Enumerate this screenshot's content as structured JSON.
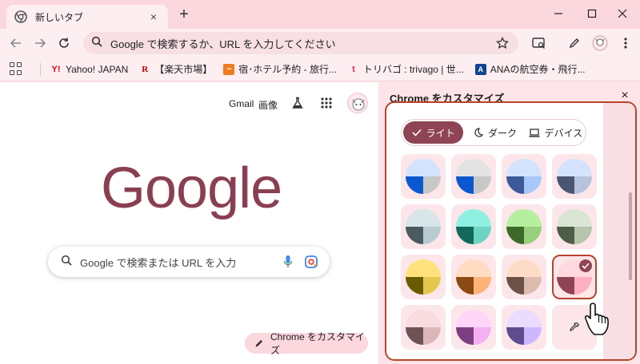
{
  "tab": {
    "title": "新しいタブ",
    "favicon": "chrome-icon",
    "close": "×",
    "new_tab": "+"
  },
  "window_controls": [
    "minimize-icon",
    "maximize-icon",
    "close-icon"
  ],
  "omnibox": {
    "text": "Google で検索するか、URL を入力してください"
  },
  "bookmarks": [
    {
      "label": "Yahoo! JAPAN",
      "icon": "Y!",
      "color": "#e60012"
    },
    {
      "label": "【楽天市場】",
      "icon": "R",
      "color": "#bf0000"
    },
    {
      "label": "宿･ホテル予約 - 旅行...",
      "icon": "~",
      "color": "#f07c1e"
    },
    {
      "label": "トリバゴ : trivago | 世...",
      "icon": "t",
      "color": "#e32851"
    },
    {
      "label": "ANAの航空券・飛行...",
      "icon": "A",
      "color": "#13448f"
    }
  ],
  "ntp": {
    "links": {
      "gmail": "Gmail",
      "images": "画像"
    },
    "logo": "Google",
    "search_placeholder": "Google で検索または URL を入力",
    "customize_label": "Chrome をカスタマイズ"
  },
  "panel": {
    "title": "Chrome をカスタマイズ",
    "close": "×",
    "modes": [
      {
        "label": "ライト",
        "icon": "check-icon",
        "selected": true
      },
      {
        "label": "ダーク",
        "icon": "moon-icon",
        "selected": false
      },
      {
        "label": "デバイス",
        "icon": "laptop-icon",
        "selected": false
      }
    ],
    "swatches": [
      {
        "top": "#d3e3fd",
        "bl": "#0b57d0",
        "br": "#c7c7c7"
      },
      {
        "top": "#e3e3e3",
        "bl": "#0b57d0",
        "br": "#c7c7c7"
      },
      {
        "top": "#d3e3fd",
        "bl": "#3c5a9a",
        "br": "#a8c7fa"
      },
      {
        "top": "#d3e3fd",
        "bl": "#4a5571",
        "br": "#b7c3dc"
      },
      {
        "top": "#d8e6ea",
        "bl": "#4b5b60",
        "br": "#b7cbd1"
      },
      {
        "top": "#8ff0e2",
        "bl": "#136a5c",
        "br": "#6dd4c4"
      },
      {
        "top": "#b6ef9f",
        "bl": "#3d6a2a",
        "br": "#98d17c"
      },
      {
        "top": "#dbe5d3",
        "bl": "#4e5d48",
        "br": "#b5c4ab"
      },
      {
        "top": "#ffe27d",
        "bl": "#6b5b00",
        "br": "#e3c84f"
      },
      {
        "top": "#ffdcc2",
        "bl": "#8a4a12",
        "br": "#ffb278"
      },
      {
        "top": "#ffdcc7",
        "bl": "#6b5147",
        "br": "#dbbcae"
      },
      {
        "top": "#ffd9df",
        "bl": "#8f4455",
        "br": "#ffb0c0",
        "selected": true
      },
      {
        "top": "#f9dcdf",
        "bl": "#6e5254",
        "br": "#dbb7ba"
      },
      {
        "top": "#ffd6fa",
        "bl": "#7e3f82",
        "br": "#f5b0f2"
      },
      {
        "top": "#eadcff",
        "bl": "#5e4d8c",
        "br": "#cbb8ff"
      }
    ],
    "eyedropper": "eyedropper-icon"
  }
}
